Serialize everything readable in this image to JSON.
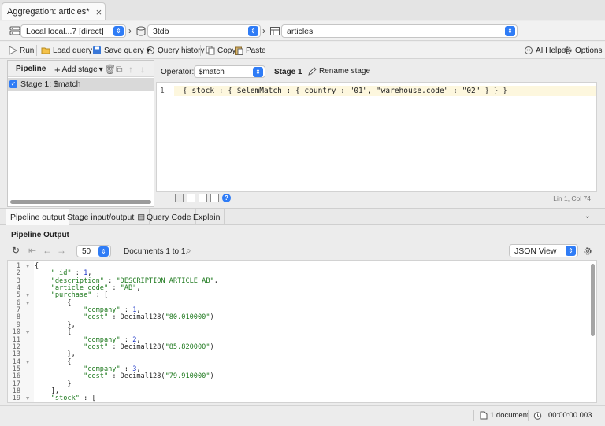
{
  "tab": {
    "title": "Aggregation: articles*",
    "close": "×"
  },
  "connection": {
    "server": "Local local...7 [direct]",
    "database": "3tdb",
    "collection": "articles",
    "select_indicator": "⇕"
  },
  "toolbar": {
    "run": "Run",
    "load_query": "Load query",
    "save_query": "Save query",
    "query_history": "Query history",
    "copy": "Copy",
    "paste": "Paste",
    "ai_helper": "AI Helper",
    "options": "Options"
  },
  "pipeline": {
    "title": "Pipeline",
    "add_stage": "Add stage",
    "stages": [
      {
        "label": "Stage 1: $match",
        "checked": true
      }
    ]
  },
  "stage_editor": {
    "operator_label": "Operator:",
    "operator_value": "$match",
    "stage_name": "Stage 1",
    "rename": "Rename stage",
    "line_number": "1",
    "query": "{ stock : { $elemMatch : { country : \"01\", \"warehouse.code\" : \"02\" } } }",
    "help": "?",
    "cursor_position": "Lin 1, Col 74"
  },
  "bottom_tabs": [
    "Pipeline output",
    "Stage input/output",
    "Query Code",
    "Explain"
  ],
  "output": {
    "title": "Pipeline Output",
    "page_size": "50",
    "range": "Documents 1 to 1",
    "view_mode": "JSON View",
    "lines": [
      {
        "n": "1",
        "fold": true,
        "text": "{"
      },
      {
        "n": "2",
        "fold": false,
        "text": "    \"_id\" : 1,"
      },
      {
        "n": "3",
        "fold": false,
        "text": "    \"description\" : \"DESCRIPTION ARTICLE AB\","
      },
      {
        "n": "4",
        "fold": false,
        "text": "    \"article_code\" : \"AB\","
      },
      {
        "n": "5",
        "fold": true,
        "text": "    \"purchase\" : ["
      },
      {
        "n": "6",
        "fold": true,
        "text": "        {"
      },
      {
        "n": "7",
        "fold": false,
        "text": "            \"company\" : 1,"
      },
      {
        "n": "8",
        "fold": false,
        "text": "            \"cost\" : Decimal128(\"80.010000\")"
      },
      {
        "n": "9",
        "fold": false,
        "text": "        },"
      },
      {
        "n": "10",
        "fold": true,
        "text": "        {"
      },
      {
        "n": "11",
        "fold": false,
        "text": "            \"company\" : 2,"
      },
      {
        "n": "12",
        "fold": false,
        "text": "            \"cost\" : Decimal128(\"85.820000\")"
      },
      {
        "n": "13",
        "fold": false,
        "text": "        },"
      },
      {
        "n": "14",
        "fold": true,
        "text": "        {"
      },
      {
        "n": "15",
        "fold": false,
        "text": "            \"company\" : 3,"
      },
      {
        "n": "16",
        "fold": false,
        "text": "            \"cost\" : Decimal128(\"79.910000\")"
      },
      {
        "n": "17",
        "fold": false,
        "text": "        }"
      },
      {
        "n": "18",
        "fold": false,
        "text": "    ],"
      },
      {
        "n": "19",
        "fold": true,
        "text": "    \"stock\" : ["
      }
    ]
  },
  "status": {
    "documents": "1 document",
    "elapsed": "00:00:00.003"
  },
  "colors": {
    "accent": "#2f7cf6",
    "key": "#1f7a1f",
    "number": "#1a35c7",
    "highlight": "#fdf7de"
  }
}
